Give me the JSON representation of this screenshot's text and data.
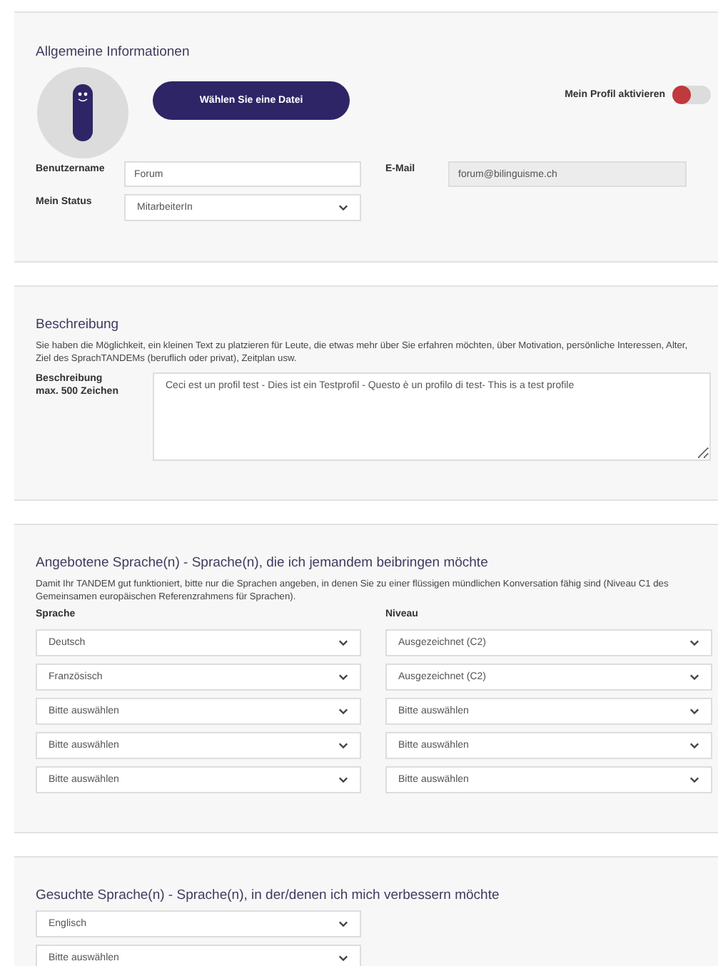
{
  "general": {
    "title": "Allgemeine Informationen",
    "upload_button": "Wählen Sie eine Datei",
    "activate": {
      "label": "Mein Profil aktivieren",
      "on": false
    },
    "username": {
      "label": "Benutzername",
      "value": "Forum"
    },
    "email": {
      "label": "E-Mail",
      "value": "forum@bilinguisme.ch",
      "disabled": true
    },
    "status": {
      "label": "Mein Status",
      "value": "MitarbeiterIn"
    }
  },
  "description": {
    "title": "Beschreibung",
    "text": "Sie haben die Möglichkeit, ein kleinen Text zu platzieren für Leute, die etwas mehr über Sie erfahren möchten, über Motivation, persönliche Interessen, Alter, Ziel des SprachTANDEMs (beruflich oder privat), Zeitplan usw.",
    "label": "Beschreibung",
    "sublabel": "max. 500 Zeichen",
    "value": "Ceci est un profil test - Dies ist ein Testprofil - Questo è un profilo di test- This is a test profile"
  },
  "offered": {
    "title": "Angebotene Sprache(n) - Sprache(n), die ich jemandem beibringen möchte",
    "text": "Damit Ihr TANDEM gut funktioniert, bitte nur die Sprachen angeben, in denen Sie zu einer flüssigen mündlichen Konversation fähig sind (Niveau C1 des Gemeinsamen europäischen Referenzrahmens für Sprachen).",
    "columns": [
      "Sprache",
      "Niveau"
    ],
    "rows": [
      {
        "language": "Deutsch",
        "level": "Ausgezeichnet (C2)"
      },
      {
        "language": "Französisch",
        "level": "Ausgezeichnet (C2)"
      },
      {
        "language": "Bitte auswählen",
        "level": "Bitte auswählen"
      },
      {
        "language": "Bitte auswählen",
        "level": "Bitte auswählen"
      },
      {
        "language": "Bitte auswählen",
        "level": "Bitte auswählen"
      }
    ]
  },
  "wanted": {
    "title": "Gesuchte Sprache(n) - Sprache(n), in der/denen ich mich verbessern möchte",
    "rows": [
      "Englisch",
      "Bitte auswählen"
    ]
  }
}
